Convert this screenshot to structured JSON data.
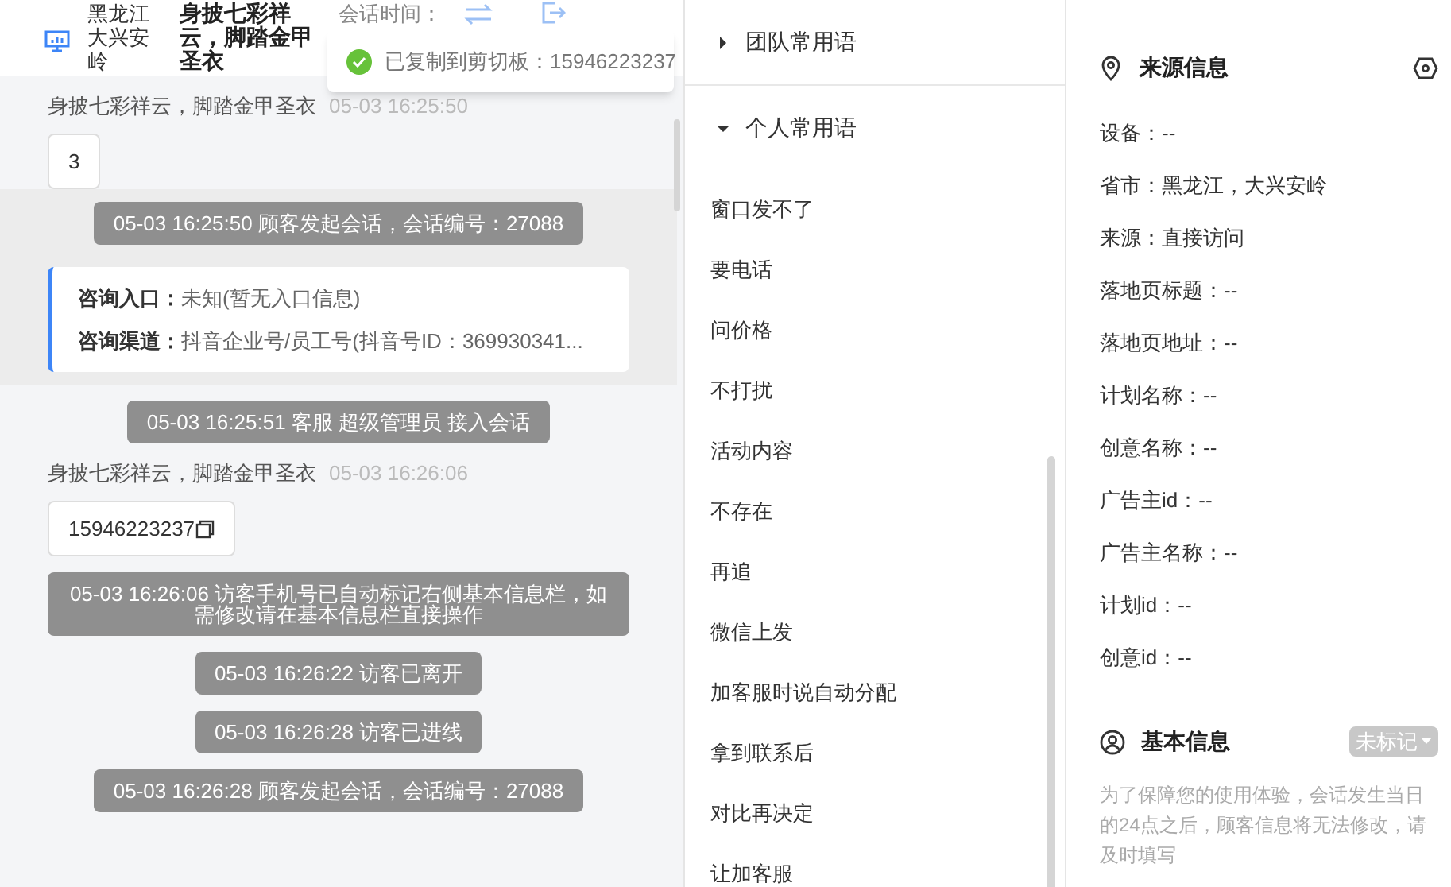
{
  "header": {
    "location": "黑龙江大兴安岭",
    "visitor_name": "身披七彩祥云，脚踏金甲圣衣",
    "session_time_label": "会话时间："
  },
  "toast": {
    "text": "已复制到剪切板：15946223237"
  },
  "messages": [
    {
      "kind": "sender",
      "name": "身披七彩祥云，脚踏金甲圣衣",
      "time": "05-03 16:25:50"
    },
    {
      "kind": "bubble",
      "text": "3",
      "copyable": false
    },
    {
      "kind": "system",
      "text": "05-03 16:25:50 顾客发起会话，会话编号：27088",
      "highlighted": true
    },
    {
      "kind": "entry_card",
      "rows": [
        {
          "label": "咨询入口：",
          "value": "未知(暂无入口信息)"
        },
        {
          "label": "咨询渠道：",
          "value": "抖音企业号/员工号(抖音号ID：369930341..."
        }
      ]
    },
    {
      "kind": "system",
      "text": "05-03 16:25:51 客服 超级管理员 接入会话",
      "highlighted": false
    },
    {
      "kind": "sender",
      "name": "身披七彩祥云，脚踏金甲圣衣",
      "time": "05-03 16:26:06"
    },
    {
      "kind": "bubble",
      "text": "15946223237",
      "copyable": true
    },
    {
      "kind": "system",
      "text": "05-03 16:26:06 访客手机号已自动标记右侧基本信息栏，如需修改请在基本信息栏直接操作",
      "highlighted": false
    },
    {
      "kind": "system",
      "text": "05-03 16:26:22 访客已离开",
      "highlighted": false
    },
    {
      "kind": "system",
      "text": "05-03 16:26:28 访客已进线",
      "highlighted": false
    },
    {
      "kind": "system",
      "text": "05-03 16:26:28 顾客发起会话，会话编号：27088",
      "highlighted": false
    }
  ],
  "phrases": {
    "groups": [
      {
        "title": "团队常用语",
        "expanded": false
      },
      {
        "title": "个人常用语",
        "expanded": true,
        "items": [
          "窗口发不了",
          "要电话",
          "问价格",
          "不打扰",
          "活动内容",
          "不存在",
          "再追",
          "微信上发",
          "加客服时说自动分配",
          "拿到联系后",
          "对比再决定",
          "让加客服"
        ]
      }
    ]
  },
  "source_info": {
    "title": "来源信息",
    "fields": [
      "设备：--",
      "省市：黑龙江，大兴安岭",
      "来源：直接访问",
      "落地页标题：--",
      "落地页地址：--",
      "计划名称：--",
      "创意名称：--",
      "广告主id：--",
      "广告主名称：--",
      "计划id：--",
      "创意id：--"
    ]
  },
  "basic_info": {
    "title": "基本信息",
    "tag": "未标记",
    "note": "为了保障您的使用体验，会话发生当日的24点之后，顾客信息将无法修改，请及时填写"
  }
}
